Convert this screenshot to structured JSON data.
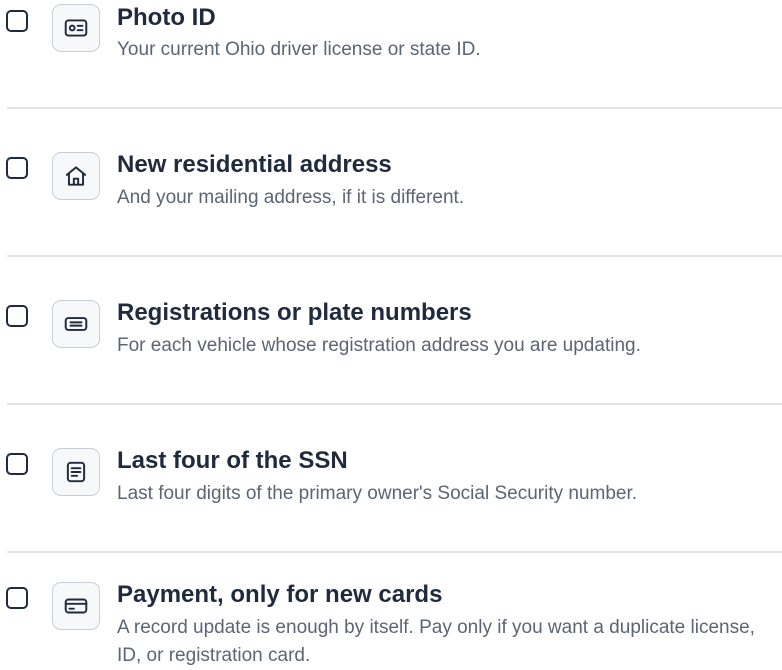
{
  "checklist": {
    "items": [
      {
        "icon": "id-card-icon",
        "title": "Photo ID",
        "description": "Your current Ohio driver license or state ID."
      },
      {
        "icon": "home-icon",
        "title": "New residential address",
        "description": "And your mailing address, if it is different."
      },
      {
        "icon": "plate-icon",
        "title": "Registrations or plate numbers",
        "description": "For each vehicle whose registration address you are updating."
      },
      {
        "icon": "document-icon",
        "title": "Last four of the SSN",
        "description": "Last four digits of the primary owner's Social Security number."
      },
      {
        "icon": "credit-card-icon",
        "title": "Payment, only for new cards",
        "description": "A record update is enough by itself. Pay only if you want a duplicate license, ID, or registration card."
      }
    ]
  },
  "colors": {
    "text_primary": "#1f2a3d",
    "text_secondary": "#5c6573",
    "divider": "#e1e4e9",
    "icon_border": "#c9ced6"
  }
}
